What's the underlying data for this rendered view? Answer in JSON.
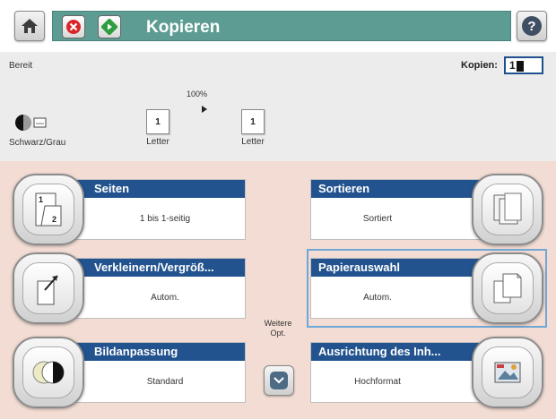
{
  "header": {
    "title": "Kopieren",
    "icons": {
      "home": "home-icon",
      "cancel": "cancel-icon",
      "start": "start-icon",
      "help": "help-icon"
    },
    "colors": {
      "strip": "#5d9c93",
      "cancel": "#d9262a",
      "start": "#2f9e3f"
    }
  },
  "status": {
    "state": "Bereit",
    "copies_label": "Kopien:",
    "copies_value": "1"
  },
  "settings_bar": {
    "color_mode_label": "Schwarz/Grau",
    "zoom": "100%",
    "source_count": "1",
    "source_paper": "Letter",
    "output_count": "1",
    "output_paper": "Letter"
  },
  "tiles": [
    {
      "title": "Seiten",
      "value": "1 bis 1-seitig",
      "icon": "sides-icon"
    },
    {
      "title": "Sortieren",
      "value": "Sortiert",
      "icon": "collate-icon"
    },
    {
      "title": "Verkleinern/Vergröß...",
      "value": "Autom.",
      "icon": "reduce-enlarge-icon"
    },
    {
      "title": "Papierauswahl",
      "value": "Autom.",
      "icon": "paper-select-icon",
      "selected": true
    },
    {
      "title": "Bildanpassung",
      "value": "Standard",
      "icon": "image-adjust-icon"
    },
    {
      "title": "Ausrichtung des Inh...",
      "value": "Hochformat",
      "icon": "orientation-icon"
    }
  ],
  "more_options": {
    "line1": "Weitere",
    "line2": "Opt."
  },
  "accent_colors": {
    "tile_header": "#22538e",
    "main_bg": "#f2dcd3",
    "status_bg": "#ececec"
  }
}
